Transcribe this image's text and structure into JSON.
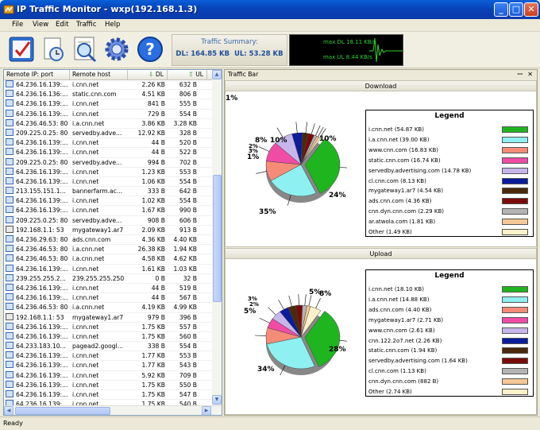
{
  "window": {
    "title": "IP Traffic Monitor - wxp(192.168.1.3)",
    "minimize": "_",
    "maximize": "□",
    "close": "✕"
  },
  "menu": [
    "File",
    "View",
    "Edit",
    "Traffic",
    "Help"
  ],
  "toolbar": {
    "icons": [
      "checklist-icon",
      "clock-document-icon",
      "search-document-icon",
      "gear-icon",
      "help-icon"
    ],
    "help_glyph": "?"
  },
  "summary": {
    "title": "Traffic Summary:",
    "dl": "DL: 164.85 KB",
    "ul": "UL: 53.28 KB"
  },
  "graph": {
    "max_dl": "max DL 18.11 KB/s",
    "max_ul": "max UL 8.44 KB/s"
  },
  "table": {
    "headers": [
      "Remote IP: port",
      "Remote host",
      "DL",
      "UL"
    ],
    "rows": [
      {
        "ip": "64.236.16.139:...",
        "host": "i.cnn.net",
        "dl": "2.26 KB",
        "ul": "632 B"
      },
      {
        "ip": "64.236.16.136:...",
        "host": "static.cnn.com",
        "dl": "4.51 KB",
        "ul": "806 B"
      },
      {
        "ip": "64.236.16.139:...",
        "host": "i.cnn.net",
        "dl": "841 B",
        "ul": "555 B"
      },
      {
        "ip": "64.236.16.139:...",
        "host": "i.cnn.net",
        "dl": "729 B",
        "ul": "554 B"
      },
      {
        "ip": "64.236.46.53: 80",
        "host": "i.a.cnn.net",
        "dl": "3.86 KB",
        "ul": "3.28 KB"
      },
      {
        "ip": "209.225.0.25: 80",
        "host": "servedby.adve...",
        "dl": "12.92 KB",
        "ul": "328 B"
      },
      {
        "ip": "64.236.16.139:...",
        "host": "i.cnn.net",
        "dl": "44 B",
        "ul": "520 B"
      },
      {
        "ip": "64.236.16.139:...",
        "host": "i.cnn.net",
        "dl": "44 B",
        "ul": "522 B"
      },
      {
        "ip": "209.225.0.25: 80",
        "host": "servedby.adve...",
        "dl": "994 B",
        "ul": "702 B"
      },
      {
        "ip": "64.236.16.139:...",
        "host": "i.cnn.net",
        "dl": "1.23 KB",
        "ul": "553 B"
      },
      {
        "ip": "64.236.16.139:...",
        "host": "i.cnn.net",
        "dl": "1.06 KB",
        "ul": "554 B"
      },
      {
        "ip": "213.155.151.1...",
        "host": "bannerfarm.ac...",
        "dl": "333 B",
        "ul": "642 B"
      },
      {
        "ip": "64.236.16.139:...",
        "host": "i.cnn.net",
        "dl": "1.02 KB",
        "ul": "554 B"
      },
      {
        "ip": "64.236.16.139:...",
        "host": "i.cnn.net",
        "dl": "1.67 KB",
        "ul": "990 B"
      },
      {
        "ip": "209.225.0.25: 80",
        "host": "servedby.adve...",
        "dl": "908 B",
        "ul": "606 B"
      },
      {
        "ip": "192.168.1.1: 53",
        "host": "mygateway1.ar7",
        "dl": "2.09 KB",
        "ul": "913 B"
      },
      {
        "ip": "64.236.29.63: 80",
        "host": "ads.cnn.com",
        "dl": "4.36 KB",
        "ul": "4.40 KB"
      },
      {
        "ip": "64.236.46.53: 80",
        "host": "i.a.cnn.net",
        "dl": "26.38 KB",
        "ul": "1.94 KB"
      },
      {
        "ip": "64.236.46.53: 80",
        "host": "i.a.cnn.net",
        "dl": "4.58 KB",
        "ul": "4.62 KB"
      },
      {
        "ip": "64.236.16.139:...",
        "host": "i.cnn.net",
        "dl": "1.61 KB",
        "ul": "1.03 KB"
      },
      {
        "ip": "239.255.255.2...",
        "host": "239.255.255.250",
        "dl": "0 B",
        "ul": "32 B"
      },
      {
        "ip": "64.236.16.139:...",
        "host": "i.cnn.net",
        "dl": "44 B",
        "ul": "519 B"
      },
      {
        "ip": "64.236.16.139:...",
        "host": "i.cnn.net",
        "dl": "44 B",
        "ul": "567 B"
      },
      {
        "ip": "64.236.46.53: 80",
        "host": "i.a.cnn.net",
        "dl": "4.19 KB",
        "ul": "4.99 KB"
      },
      {
        "ip": "192.168.1.1: 53",
        "host": "mygateway1.ar7",
        "dl": "979 B",
        "ul": "396 B"
      },
      {
        "ip": "64.236.16.139:...",
        "host": "i.cnn.net",
        "dl": "1.75 KB",
        "ul": "557 B"
      },
      {
        "ip": "64.236.16.139:...",
        "host": "i.cnn.net",
        "dl": "1.75 KB",
        "ul": "560 B"
      },
      {
        "ip": "64.233.183.10...",
        "host": "pagead2.googl...",
        "dl": "338 B",
        "ul": "554 B"
      },
      {
        "ip": "64.236.16.139:...",
        "host": "i.cnn.net",
        "dl": "1.77 KB",
        "ul": "553 B"
      },
      {
        "ip": "64.236.16.139:...",
        "host": "i.cnn.net",
        "dl": "1.77 KB",
        "ul": "543 B"
      },
      {
        "ip": "64.236.16.139:...",
        "host": "i.cnn.net",
        "dl": "5.92 KB",
        "ul": "709 B"
      },
      {
        "ip": "64.236.16.139:...",
        "host": "i.cnn.net",
        "dl": "1.75 KB",
        "ul": "550 B"
      },
      {
        "ip": "64.236.16.139:...",
        "host": "i.cnn.net",
        "dl": "1.75 KB",
        "ul": "547 B"
      },
      {
        "ip": "64.236.16.139:...",
        "host": "i.cnn.net",
        "dl": "1.75 KB",
        "ul": "540 B"
      }
    ]
  },
  "traffic_bar": {
    "title": "Traffic Bar",
    "pin": "ꟷ",
    "close": "✕",
    "download": {
      "header": "Download",
      "corner_label": "1%",
      "legend_title": "Legend",
      "items": [
        {
          "label": "i.cnn.net (54.87 KB)",
          "color": "#1fb51f"
        },
        {
          "label": "i.a.cnn.net (39.00 KB)",
          "color": "#8ef0f0"
        },
        {
          "label": "www.cnn.com (16.83 KB)",
          "color": "#f48c78"
        },
        {
          "label": "static.cnn.com (16.74 KB)",
          "color": "#f04ca6"
        },
        {
          "label": "servedby.advertising.com (14.78 KB)",
          "color": "#c6b6ea"
        },
        {
          "label": "cl.cnn.com (8.13 KB)",
          "color": "#0a1c9c"
        },
        {
          "label": "mygateway1.ar7 (4.54 KB)",
          "color": "#4a2a0a"
        },
        {
          "label": "ads.cnn.com (4.36 KB)",
          "color": "#7a0a0a"
        },
        {
          "label": "cnn.dyn.cnn.com (2.29 KB)",
          "color": "#b4b4b4"
        },
        {
          "label": "ar.atwola.com (1.81 KB)",
          "color": "#f6c896"
        },
        {
          "label": "Other (1.49 KB)",
          "color": "#fff2c8"
        }
      ],
      "pie_labels": [
        "10%",
        "10%",
        "8%",
        "2%",
        "3%",
        "1%",
        "24%",
        "35%"
      ]
    },
    "upload": {
      "header": "Upload",
      "legend_title": "Legend",
      "items": [
        {
          "label": "i.cnn.net (18.10 KB)",
          "color": "#1fb51f"
        },
        {
          "label": "i.a.cnn.net (14.88 KB)",
          "color": "#8ef0f0"
        },
        {
          "label": "ads.cnn.com (4.40 KB)",
          "color": "#f48c78"
        },
        {
          "label": "mygateway1.ar7 (2.71 KB)",
          "color": "#f04ca6"
        },
        {
          "label": "www.cnn.com (2.61 KB)",
          "color": "#c6b6ea"
        },
        {
          "label": "cnn.122.2o7.net (2.26 KB)",
          "color": "#0a1c9c"
        },
        {
          "label": "static.cnn.com (1.94 KB)",
          "color": "#4a2a0a"
        },
        {
          "label": "servedby.advertising.com (1.64 KB)",
          "color": "#7a0a0a"
        },
        {
          "label": "cl.cnn.com (1.13 KB)",
          "color": "#b4b4b4"
        },
        {
          "label": "cnn.dyn.cnn.com (882 B)",
          "color": "#f6c896"
        },
        {
          "label": "Other (2.74 KB)",
          "color": "#fff2c8"
        }
      ],
      "pie_labels": [
        "5%",
        "8%",
        "5%",
        "3%",
        "2%",
        "28%",
        "34%"
      ]
    }
  },
  "status": "Ready"
}
